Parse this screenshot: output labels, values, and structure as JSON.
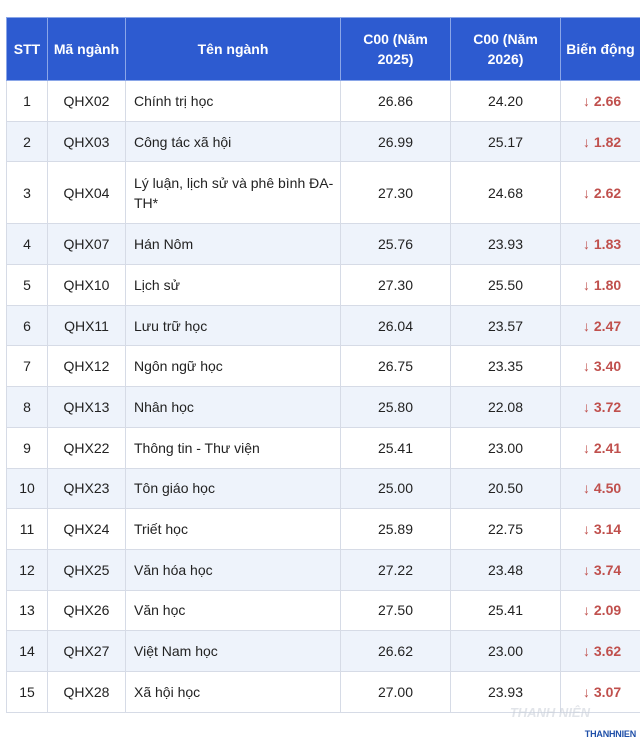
{
  "headers": {
    "stt": "STT",
    "code": "Mã ngành",
    "name": "Tên ngành",
    "score2025": "C00 (Năm 2025)",
    "score2026": "C00 (Năm 2026)",
    "change": "Biến động"
  },
  "rows": [
    {
      "stt": "1",
      "code": "QHX02",
      "name": "Chính trị học",
      "score2025": "26.86",
      "score2026": "24.20",
      "arrow": "↓",
      "change": "2.66"
    },
    {
      "stt": "2",
      "code": "QHX03",
      "name": "Công tác xã hội",
      "score2025": "26.99",
      "score2026": "25.17",
      "arrow": "↓",
      "change": "1.82"
    },
    {
      "stt": "3",
      "code": "QHX04",
      "name": "Lý luận, lịch sử và phê bình ĐA-TH*",
      "score2025": "27.30",
      "score2026": "24.68",
      "arrow": "↓",
      "change": "2.62"
    },
    {
      "stt": "4",
      "code": "QHX07",
      "name": "Hán Nôm",
      "score2025": "25.76",
      "score2026": "23.93",
      "arrow": "↓",
      "change": "1.83"
    },
    {
      "stt": "5",
      "code": "QHX10",
      "name": "Lịch sử",
      "score2025": "27.30",
      "score2026": "25.50",
      "arrow": "↓",
      "change": "1.80"
    },
    {
      "stt": "6",
      "code": "QHX11",
      "name": "Lưu trữ học",
      "score2025": "26.04",
      "score2026": "23.57",
      "arrow": "↓",
      "change": "2.47"
    },
    {
      "stt": "7",
      "code": "QHX12",
      "name": "Ngôn ngữ học",
      "score2025": "26.75",
      "score2026": "23.35",
      "arrow": "↓",
      "change": "3.40"
    },
    {
      "stt": "8",
      "code": "QHX13",
      "name": "Nhân học",
      "score2025": "25.80",
      "score2026": "22.08",
      "arrow": "↓",
      "change": "3.72"
    },
    {
      "stt": "9",
      "code": "QHX22",
      "name": "Thông tin - Thư viện",
      "score2025": "25.41",
      "score2026": "23.00",
      "arrow": "↓",
      "change": "2.41"
    },
    {
      "stt": "10",
      "code": "QHX23",
      "name": "Tôn giáo học",
      "score2025": "25.00",
      "score2026": "20.50",
      "arrow": "↓",
      "change": "4.50"
    },
    {
      "stt": "11",
      "code": "QHX24",
      "name": "Triết học",
      "score2025": "25.89",
      "score2026": "22.75",
      "arrow": "↓",
      "change": "3.14"
    },
    {
      "stt": "12",
      "code": "QHX25",
      "name": "Văn hóa học",
      "score2025": "27.22",
      "score2026": "23.48",
      "arrow": "↓",
      "change": "3.74"
    },
    {
      "stt": "13",
      "code": "QHX26",
      "name": "Văn học",
      "score2025": "27.50",
      "score2026": "25.41",
      "arrow": "↓",
      "change": "2.09"
    },
    {
      "stt": "14",
      "code": "QHX27",
      "name": "Việt Nam học",
      "score2025": "26.62",
      "score2026": "23.00",
      "arrow": "↓",
      "change": "3.62"
    },
    {
      "stt": "15",
      "code": "QHX28",
      "name": "Xã hội học",
      "score2025": "27.00",
      "score2026": "23.93",
      "arrow": "↓",
      "change": "3.07"
    }
  ],
  "watermark": {
    "ghost": "THANH NIÊN",
    "logo": "THANHNIEN"
  },
  "colors": {
    "header_bg": "#2d5bd0",
    "header_text": "#ffffff",
    "row_alt_bg": "#eef3fb",
    "decrease": "#c0504d"
  }
}
